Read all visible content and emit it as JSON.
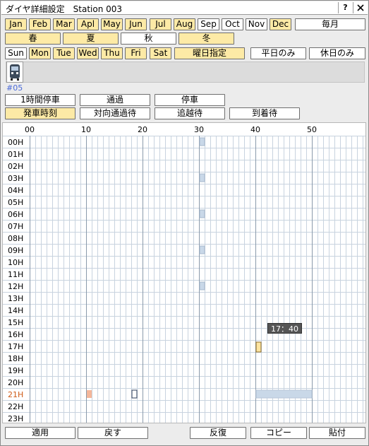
{
  "title": "ダイヤ詳細設定　Station 003",
  "titlebar_buttons": {
    "help": "?",
    "close": "x"
  },
  "months": [
    {
      "label": "Jan",
      "on": true
    },
    {
      "label": "Feb",
      "on": true
    },
    {
      "label": "Mar",
      "on": true
    },
    {
      "label": "Apl",
      "on": true
    },
    {
      "label": "May",
      "on": true
    },
    {
      "label": "Jun",
      "on": true
    },
    {
      "label": "Jul",
      "on": true
    },
    {
      "label": "Aug",
      "on": true
    },
    {
      "label": "Sep",
      "on": false
    },
    {
      "label": "Oct",
      "on": false
    },
    {
      "label": "Nov",
      "on": false
    },
    {
      "label": "Dec",
      "on": true
    }
  ],
  "monthly_label": "毎月",
  "seasons": [
    {
      "label": "春",
      "on": true
    },
    {
      "label": "夏",
      "on": true
    },
    {
      "label": "秋",
      "on": false
    },
    {
      "label": "冬",
      "on": true
    }
  ],
  "days": [
    {
      "label": "Sun",
      "on": false
    },
    {
      "label": "Mon",
      "on": true
    },
    {
      "label": "Tue",
      "on": true
    },
    {
      "label": "Wed",
      "on": true
    },
    {
      "label": "Thu",
      "on": true
    },
    {
      "label": "Fri",
      "on": true
    },
    {
      "label": "Sat",
      "on": true
    }
  ],
  "day_specify_label": "曜日指定",
  "weekdays_only_label": "平日のみ",
  "holidays_only_label": "休日のみ",
  "train_number": "#05",
  "mode_buttons_row1": [
    {
      "label": "1時間停車",
      "on": false
    },
    {
      "label": "通過",
      "on": false
    },
    {
      "label": "停車",
      "on": false
    }
  ],
  "mode_buttons_row2": [
    {
      "label": "発車時刻",
      "on": true
    },
    {
      "label": "対向通過待",
      "on": false
    },
    {
      "label": "追越待",
      "on": false
    },
    {
      "label": "到着待",
      "on": false
    }
  ],
  "minute_labels": [
    "00",
    "10",
    "20",
    "30",
    "40",
    "50"
  ],
  "hour_labels": [
    "00H",
    "01H",
    "02H",
    "03H",
    "04H",
    "05H",
    "06H",
    "07H",
    "08H",
    "09H",
    "10H",
    "11H",
    "12H",
    "13H",
    "14H",
    "15H",
    "16H",
    "17H",
    "18H",
    "19H",
    "20H",
    "21H",
    "22H",
    "23H"
  ],
  "highlight_hour": "21H",
  "tooltip_text": "17：40",
  "bottom_buttons": {
    "apply": "適用",
    "back": "戻す",
    "repeat": "反復",
    "copy": "コピー",
    "paste": "貼付"
  },
  "colors": {
    "toggle_on": "#fdeaa6",
    "grid_minor": "#c8d3df",
    "grid_major": "#8a9aab",
    "marker_blue": "#c9d8e8",
    "marker_orange": "#f4b69a",
    "marker_selected": "#fde4a0",
    "hour_highlight": "#cf5a16"
  }
}
